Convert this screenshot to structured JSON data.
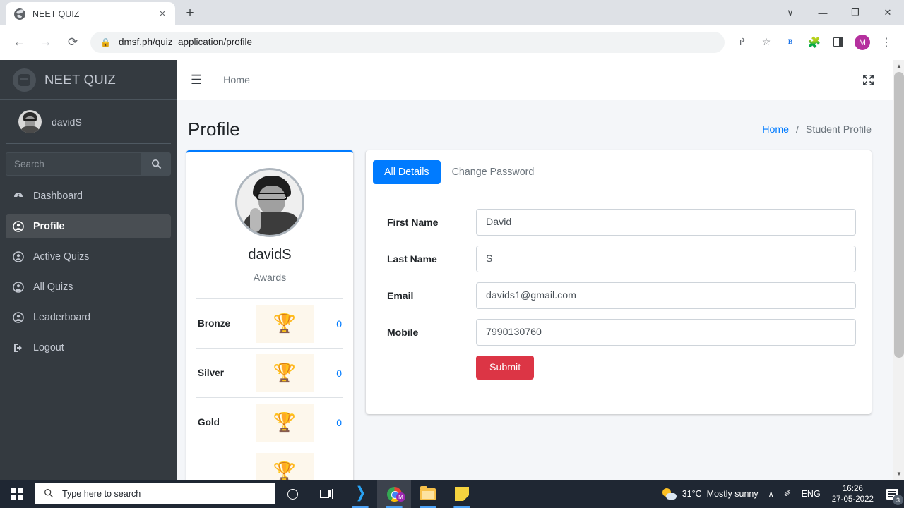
{
  "browser": {
    "tab": {
      "title": "NEET QUIZ",
      "favicon": "globe-icon",
      "close": "×"
    },
    "newtab_label": "+",
    "window_controls": {
      "minimize_all": "∨",
      "minimize": "—",
      "maximize": "❐",
      "close": "✕"
    },
    "nav": {
      "back": "←",
      "forward": "→",
      "reload": "⟳"
    },
    "omnibox": {
      "lock": "🔒",
      "url": "dmsf.ph/quiz_application/profile"
    },
    "toolbar_icons": {
      "share": "↱",
      "bookmark": "☆",
      "extension_b": "B",
      "puzzle": "🧩",
      "profile_initial": "M",
      "menu": "⋮"
    },
    "status_tooltip": "https://dmsf.ph/quiz_application/profile"
  },
  "sidebar": {
    "brand": "NEET QUIZ",
    "user": "davidS",
    "search": {
      "placeholder": "Search",
      "value": "",
      "button_icon": "search-icon"
    },
    "items": [
      {
        "label": "Dashboard",
        "icon": "dashboard-icon",
        "active": false
      },
      {
        "label": "Profile",
        "icon": "user-circle-icon",
        "active": true
      },
      {
        "label": "Active Quizs",
        "icon": "user-circle-icon",
        "active": false
      },
      {
        "label": "All Quizs",
        "icon": "user-circle-icon",
        "active": false
      },
      {
        "label": "Leaderboard",
        "icon": "user-circle-icon",
        "active": false
      },
      {
        "label": "Logout",
        "icon": "logout-icon",
        "active": false
      }
    ]
  },
  "topbar": {
    "menu_toggle": "☰",
    "home_link": "Home",
    "fullscreen_icon": "expand-icon"
  },
  "page": {
    "title": "Profile",
    "breadcrumb": {
      "home": "Home",
      "separator": "/",
      "current": "Student Profile"
    }
  },
  "profile_card": {
    "avatar": "user-photo",
    "name": "davidS",
    "section_label": "Awards",
    "awards": [
      {
        "label": "Bronze",
        "icon": "trophy-icon",
        "count": "0"
      },
      {
        "label": "Silver",
        "icon": "trophy-icon",
        "count": "0"
      },
      {
        "label": "Gold",
        "icon": "trophy-icon",
        "count": "0"
      }
    ]
  },
  "details_card": {
    "tabs": [
      {
        "label": "All Details",
        "active": true
      },
      {
        "label": "Change Password",
        "active": false
      }
    ],
    "fields": [
      {
        "label": "First Name",
        "value": "David"
      },
      {
        "label": "Last Name",
        "value": "S"
      },
      {
        "label": "Email",
        "value": "davids1@gmail.com"
      },
      {
        "label": "Mobile",
        "value": "7990130760"
      }
    ],
    "submit_label": "Submit"
  },
  "taskbar": {
    "start": "windows-logo",
    "search_placeholder": "Type here to search",
    "apps": [
      {
        "name": "cortana",
        "icon": "circle-icon"
      },
      {
        "name": "task-view",
        "icon": "taskview-icon"
      },
      {
        "name": "vs-code",
        "icon": "vscode-icon"
      },
      {
        "name": "chrome",
        "icon": "chrome-icon"
      },
      {
        "name": "file-explorer",
        "icon": "folder-icon"
      },
      {
        "name": "sticky-notes",
        "icon": "sticky-note-icon"
      }
    ],
    "tray": {
      "weather_temp": "31°C",
      "weather_desc": "Mostly sunny",
      "chevron": "∧",
      "pen": "✐",
      "language": "ENG",
      "time": "16:26",
      "date": "27-05-2022",
      "notification_count": "3"
    }
  },
  "colors": {
    "sidebar_bg": "#343a40",
    "accent_blue": "#007bff",
    "danger_red": "#dc3545",
    "page_bg": "#f4f6f9",
    "taskbar_bg": "#1f2733"
  }
}
